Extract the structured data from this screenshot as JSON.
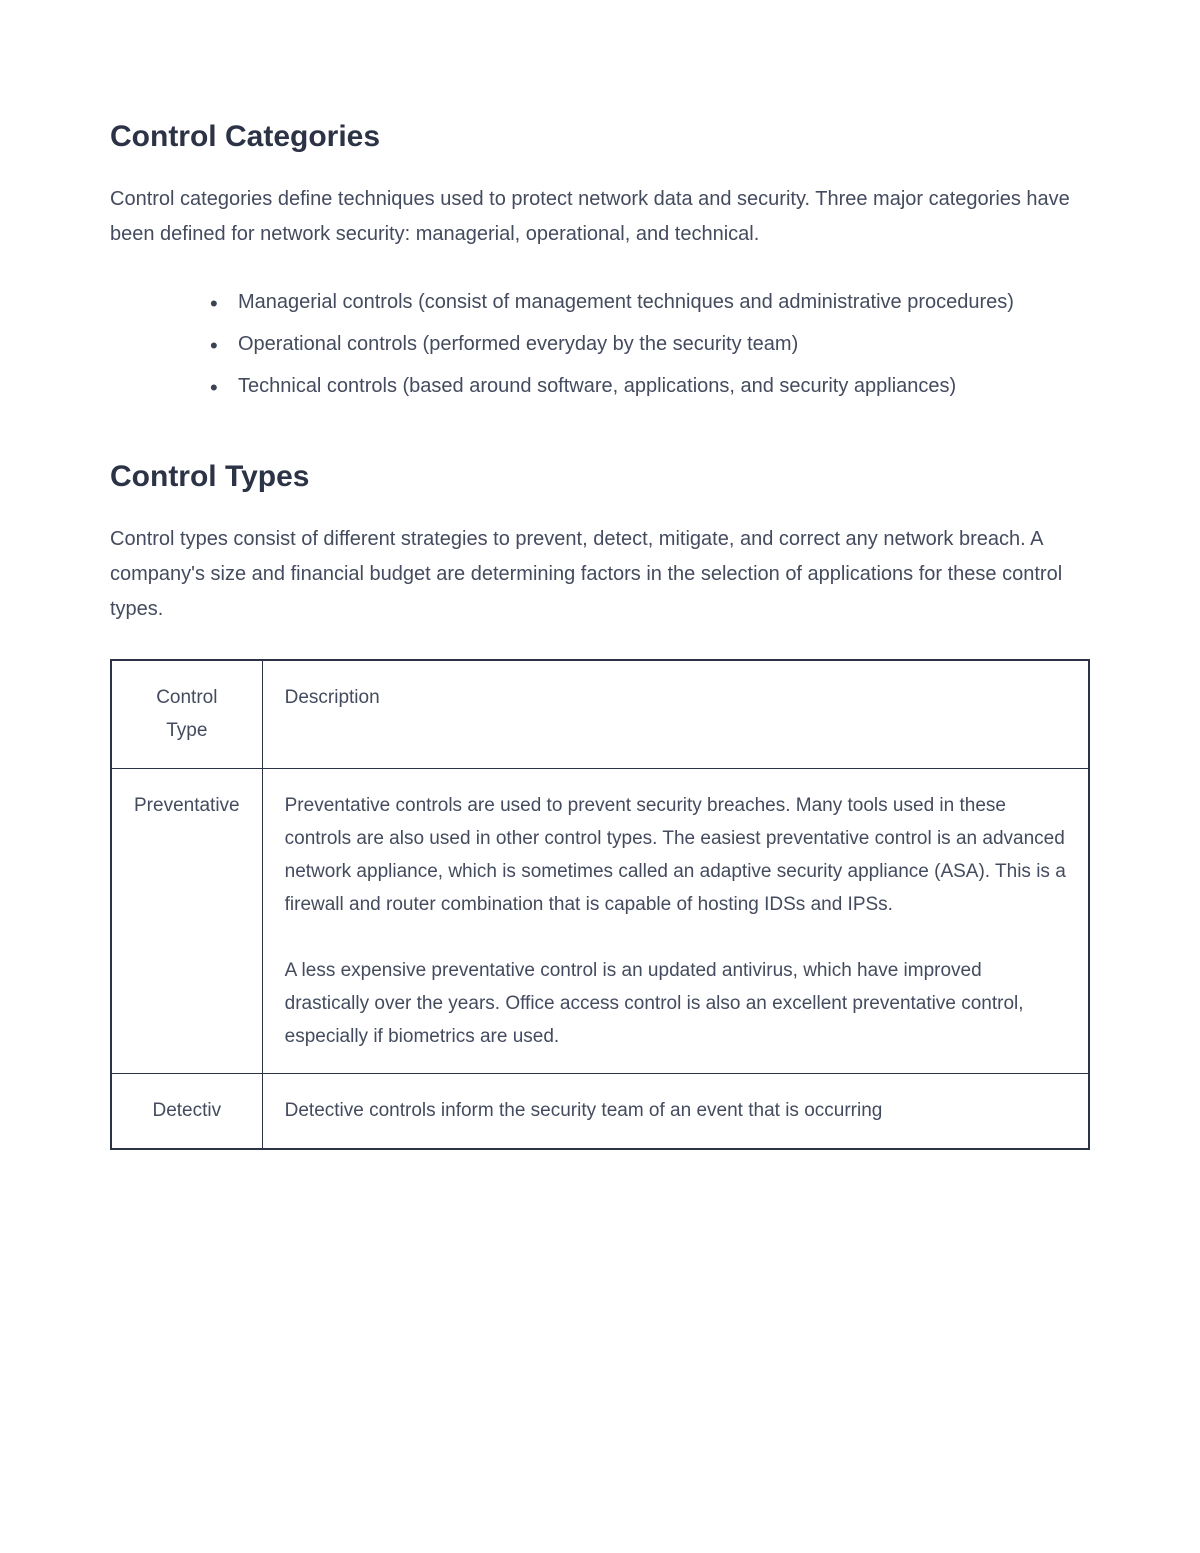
{
  "section1": {
    "heading": "Control Categories",
    "paragraph": "Control categories define techniques used to protect network data and security. Three major categories have been defined for network security: managerial, operational, and technical.",
    "bullets": [
      "Managerial controls (consist of management techniques and administrative procedures)",
      "Operational controls (performed everyday by the security team)",
      "Technical controls (based around software, applications, and security appliances)"
    ]
  },
  "section2": {
    "heading": "Control Types",
    "paragraph": "Control types consist of different strategies to prevent, detect, mitigate, and correct any network breach. A company's size and financial budget are determining factors in the selection of applications for these control types."
  },
  "table": {
    "header": {
      "type": "Control Type",
      "desc": "Description"
    },
    "rows": [
      {
        "type": "Preventative",
        "desc_p1": "Preventative controls are used to prevent security breaches. Many tools used in these controls are also used in other control types. The easiest preventative control is an advanced network appliance, which is sometimes called an adaptive security appliance (ASA). This is a firewall and router combination that is capable of hosting IDSs and IPSs.",
        "desc_p2": "A less expensive preventative control is an updated antivirus, which have improved drastically over the years. Office access control is also an excellent preventative control, especially if biometrics are used."
      },
      {
        "type": "Detectiv",
        "desc_p1": "Detective controls inform the security team of an event that is occurring",
        "desc_p2": ""
      }
    ]
  }
}
